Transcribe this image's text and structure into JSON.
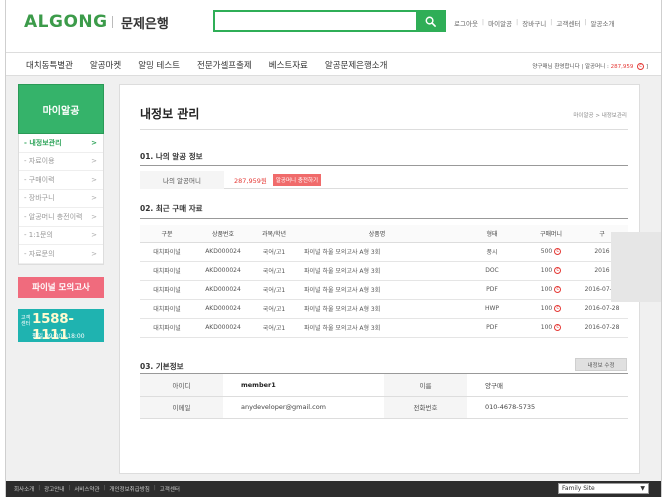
{
  "header": {
    "logo": "ALG",
    "logo_o": "O",
    "logo_end": "NG",
    "service_name": "문제은행",
    "search_placeholder": "",
    "util_links": [
      "로그아웃",
      "마이알공",
      "장바구니",
      "고객센터",
      "알공소개"
    ]
  },
  "nav": {
    "items": [
      "대치동특별관",
      "알공마켓",
      "알밍 테스트",
      "전문가셀프출제",
      "베스트자료",
      "알공문제은행소개"
    ],
    "user_greeting": "양구매님 환영합니다 | 알공머니 : ",
    "user_money": "287,959",
    "user_suffix": " ]"
  },
  "sidebar": {
    "title": "마이알공",
    "items": [
      {
        "label": "- 내정보관리",
        "active": true
      },
      {
        "label": "- 자료이용",
        "active": false
      },
      {
        "label": "- 구매이력",
        "active": false
      },
      {
        "label": "- 장바구니",
        "active": false
      },
      {
        "label": "- 알공머니 충전이력",
        "active": false
      },
      {
        "label": "- 1:1문의",
        "active": false
      },
      {
        "label": "- 자료문의",
        "active": false
      }
    ],
    "promo": "파이널 모의고사",
    "contact_label": "고객센터",
    "contact_phone": "1588-1111",
    "contact_hours": "평일 09:00~18:00"
  },
  "content": {
    "title": "내정보 관리",
    "breadcrumb": "마이알공 > 내정보관리",
    "section1": {
      "title": "01. 나의 알공 정보",
      "label": "나의 알공머니",
      "value": "287,959원",
      "charge_button": "알공머니 충전하기"
    },
    "section2": {
      "title": "02. 최근 구매 자료",
      "headers": [
        "구분",
        "상품번호",
        "과목/학년",
        "상품명",
        "형태",
        "구매머니",
        "구"
      ],
      "rows": [
        {
          "type": "대치파이널",
          "code": "AKD000024",
          "subject": "국어/고1",
          "name": "파이널 하울 모의고사 A형 3회",
          "format": "풍시",
          "price": "500",
          "date": "2016"
        },
        {
          "type": "대치파이널",
          "code": "AKD000024",
          "subject": "국어/고1",
          "name": "파이널 하울 모의고사 A형 3회",
          "format": "DOC",
          "price": "100",
          "date": "2016"
        },
        {
          "type": "대치파이널",
          "code": "AKD000024",
          "subject": "국어/고1",
          "name": "파이널 하울 모의고사 A형 3회",
          "format": "PDF",
          "price": "100",
          "date": "2016-07-29"
        },
        {
          "type": "대치파이널",
          "code": "AKD000024",
          "subject": "국어/고1",
          "name": "파이널 하울 모의고사 A형 3회",
          "format": "HWP",
          "price": "100",
          "date": "2016-07-28"
        },
        {
          "type": "대치파이널",
          "code": "AKD000024",
          "subject": "국어/고1",
          "name": "파이널 하울 모의고사 A형 3회",
          "format": "PDF",
          "price": "100",
          "date": "2016-07-28"
        }
      ]
    },
    "section3": {
      "title": "03. 기본정보",
      "edit_button": "내정보 수정",
      "id_label": "아이디",
      "id_value": "member1",
      "name_label": "이름",
      "name_value": "양구매",
      "email_label": "이메일",
      "email_value": "anydeveloper@gmail.com",
      "phone_label": "전화번호",
      "phone_value": "010-4678-5735"
    }
  },
  "footer": {
    "links": [
      "회사소개",
      "광고안내",
      "서비스약관",
      "개인정보취급방침",
      "고객센터"
    ],
    "family_site": "Family Site"
  },
  "colors": {
    "brand_green": "#2fae57",
    "accent_red": "#e53935",
    "promo_pink": "#f06b7d",
    "contact_teal": "#1fb3b0"
  }
}
